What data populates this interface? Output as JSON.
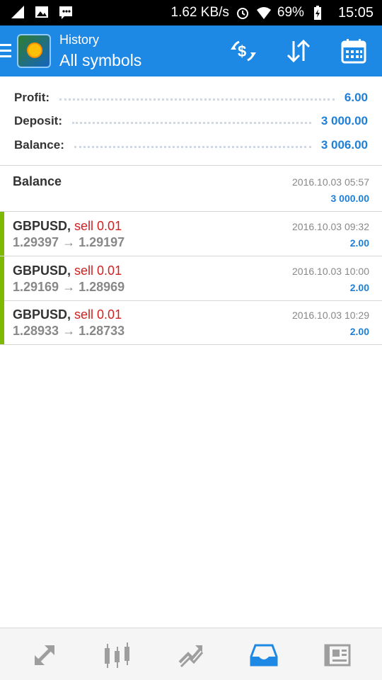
{
  "status_bar": {
    "speed": "1.62 KB/s",
    "battery": "69%",
    "time": "15:05"
  },
  "header": {
    "subtitle": "History",
    "title": "All symbols"
  },
  "summary": {
    "profit_label": "Profit:",
    "profit_value": "6.00",
    "deposit_label": "Deposit:",
    "deposit_value": "3 000.00",
    "balance_label": "Balance:",
    "balance_value": "3 006.00"
  },
  "balance_entry": {
    "label": "Balance",
    "time": "2016.10.03 05:57",
    "amount": "3 000.00"
  },
  "deals": [
    {
      "symbol": "GBPUSD,",
      "action": "sell 0.01",
      "prices": "1.29397 → 1.29197",
      "time": "2016.10.03 09:32",
      "profit": "2.00"
    },
    {
      "symbol": "GBPUSD,",
      "action": "sell 0.01",
      "prices": "1.29169 → 1.28969",
      "time": "2016.10.03 10:00",
      "profit": "2.00"
    },
    {
      "symbol": "GBPUSD,",
      "action": "sell 0.01",
      "prices": "1.28933 → 1.28733",
      "time": "2016.10.03 10:29",
      "profit": "2.00"
    }
  ],
  "colors": {
    "accent": "#1e88e5",
    "profit_bar": "#7cb900",
    "sell": "#d21f1f",
    "value": "#1e7fd6"
  },
  "icons": {
    "header": [
      "currency-exchange-icon",
      "sort-icon",
      "calendar-icon"
    ],
    "nav": [
      "quotes-icon",
      "chart-icon",
      "trade-icon",
      "history-icon",
      "news-icon"
    ]
  }
}
